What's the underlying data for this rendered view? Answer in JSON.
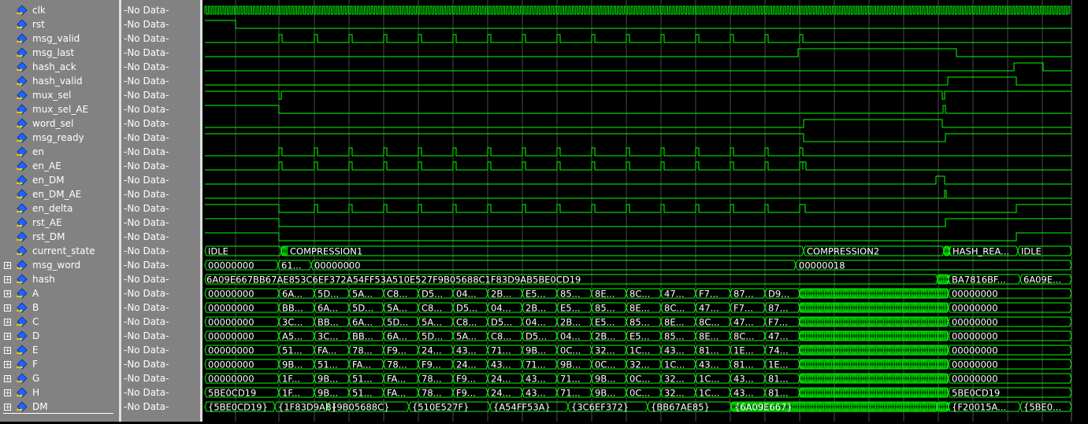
{
  "signals": [
    {
      "name": "clk",
      "value": "-No Data-",
      "kind": "bit",
      "expandable": false
    },
    {
      "name": "rst",
      "value": "-No Data-",
      "kind": "bit",
      "expandable": false
    },
    {
      "name": "msg_valid",
      "value": "-No Data-",
      "kind": "bit",
      "expandable": false
    },
    {
      "name": "msg_last",
      "value": "-No Data-",
      "kind": "bit",
      "expandable": false
    },
    {
      "name": "hash_ack",
      "value": "-No Data-",
      "kind": "bit",
      "expandable": false
    },
    {
      "name": "hash_valid",
      "value": "-No Data-",
      "kind": "bit",
      "expandable": false
    },
    {
      "name": "mux_sel",
      "value": "-No Data-",
      "kind": "bit",
      "expandable": false
    },
    {
      "name": "mux_sel_AE",
      "value": "-No Data-",
      "kind": "bit",
      "expandable": false
    },
    {
      "name": "word_sel",
      "value": "-No Data-",
      "kind": "bit",
      "expandable": false
    },
    {
      "name": "msg_ready",
      "value": "-No Data-",
      "kind": "bit",
      "expandable": false
    },
    {
      "name": "en",
      "value": "-No Data-",
      "kind": "bit",
      "expandable": false
    },
    {
      "name": "en_AE",
      "value": "-No Data-",
      "kind": "bit",
      "expandable": false
    },
    {
      "name": "en_DM",
      "value": "-No Data-",
      "kind": "bit",
      "expandable": false
    },
    {
      "name": "en_DM_AE",
      "value": "-No Data-",
      "kind": "bit",
      "expandable": false
    },
    {
      "name": "en_delta",
      "value": "-No Data-",
      "kind": "bit",
      "expandable": false
    },
    {
      "name": "rst_AE",
      "value": "-No Data-",
      "kind": "bit",
      "expandable": false
    },
    {
      "name": "rst_DM",
      "value": "-No Data-",
      "kind": "bit",
      "expandable": false
    },
    {
      "name": "current_state",
      "value": "-No Data-",
      "kind": "bus",
      "expandable": false
    },
    {
      "name": "msg_word",
      "value": "-No Data-",
      "kind": "bus",
      "expandable": true
    },
    {
      "name": "hash",
      "value": "-No Data-",
      "kind": "bus",
      "expandable": true
    },
    {
      "name": "A",
      "value": "-No Data-",
      "kind": "bus",
      "expandable": true
    },
    {
      "name": "B",
      "value": "-No Data-",
      "kind": "bus",
      "expandable": true
    },
    {
      "name": "C",
      "value": "-No Data-",
      "kind": "bus",
      "expandable": true
    },
    {
      "name": "D",
      "value": "-No Data-",
      "kind": "bus",
      "expandable": true
    },
    {
      "name": "E",
      "value": "-No Data-",
      "kind": "bus",
      "expandable": true
    },
    {
      "name": "F",
      "value": "-No Data-",
      "kind": "bus",
      "expandable": true
    },
    {
      "name": "G",
      "value": "-No Data-",
      "kind": "bus",
      "expandable": true
    },
    {
      "name": "H",
      "value": "-No Data-",
      "kind": "bus",
      "expandable": true
    },
    {
      "name": "DM",
      "value": "-No Data-",
      "kind": "bus",
      "expandable": true
    }
  ],
  "bus_labels": {
    "current_state": [
      "IDLE",
      "COMPRESSION1",
      "COMPRESSION2",
      "HASH_REA...",
      "IDLE"
    ],
    "msg_word": [
      "00000000",
      "61...",
      "00000000",
      "00000018"
    ],
    "hash": [
      "6A09E667BB67AE853C6EF372A54FF53A510E527F9B05688C1F83D9AB5BE0CD19",
      "BA7816BF...",
      "6A09E..."
    ],
    "A": [
      "00000000",
      "6A...",
      "5D...",
      "5A...",
      "C8...",
      "D5...",
      "04...",
      "2B...",
      "E5...",
      "85...",
      "8E...",
      "8C...",
      "47...",
      "F7...",
      "87...",
      "D9...",
      "00000000"
    ],
    "B": [
      "00000000",
      "BB...",
      "6A...",
      "5D...",
      "5A...",
      "C8...",
      "D5...",
      "04...",
      "2B...",
      "E5...",
      "85...",
      "8E...",
      "8C...",
      "47...",
      "F7...",
      "87...",
      "00000000"
    ],
    "C": [
      "00000000",
      "3C...",
      "BB...",
      "6A...",
      "5D...",
      "5A...",
      "C8...",
      "D5...",
      "04...",
      "2B...",
      "E5...",
      "85...",
      "8E...",
      "8C...",
      "47...",
      "F7...",
      "00000000"
    ],
    "D": [
      "00000000",
      "A5...",
      "3C...",
      "BB...",
      "6A...",
      "5D...",
      "5A...",
      "C8...",
      "D5...",
      "04...",
      "2B...",
      "E5...",
      "85...",
      "8E...",
      "8C...",
      "47...",
      "00000000"
    ],
    "E": [
      "00000000",
      "51...",
      "FA...",
      "78...",
      "F9...",
      "24...",
      "43...",
      "71...",
      "9B...",
      "0C...",
      "32...",
      "1C...",
      "43...",
      "81...",
      "1E...",
      "74...",
      "00000000"
    ],
    "F": [
      "00000000",
      "9B...",
      "51...",
      "FA...",
      "78...",
      "F9...",
      "24...",
      "43...",
      "71...",
      "9B...",
      "0C...",
      "32...",
      "1C...",
      "43...",
      "81...",
      "1E...",
      "00000000"
    ],
    "G": [
      "00000000",
      "1F...",
      "9B...",
      "51...",
      "FA...",
      "78...",
      "F9...",
      "24...",
      "43...",
      "71...",
      "9B...",
      "0C...",
      "32...",
      "1C...",
      "43...",
      "81...",
      "00000000"
    ],
    "H": [
      "5BE0CD19",
      "1F...",
      "9B...",
      "51...",
      "FA...",
      "78...",
      "F9...",
      "24...",
      "43...",
      "71...",
      "9B...",
      "0C...",
      "32...",
      "1C...",
      "43...",
      "81...",
      "5BE0CD19"
    ],
    "DM": [
      "{5BE0CD19}",
      "{1F83D9AB}",
      "{9B05688C}",
      "{510E527F}",
      "{A54FF53A}",
      "{3C6EF372}",
      "{BB67AE85}",
      "{6A09E667}",
      "{F20015A...",
      "{5BE0..."
    ]
  },
  "colors": {
    "wave": "#00ff00",
    "panel": "#828282",
    "background": "#000000",
    "grid": "#4a4a4a",
    "text": "#ffffff",
    "icon": "#1e64ff"
  },
  "icons": {
    "signal": "diamond-arrow-icon",
    "expand": "plus-box-icon"
  }
}
